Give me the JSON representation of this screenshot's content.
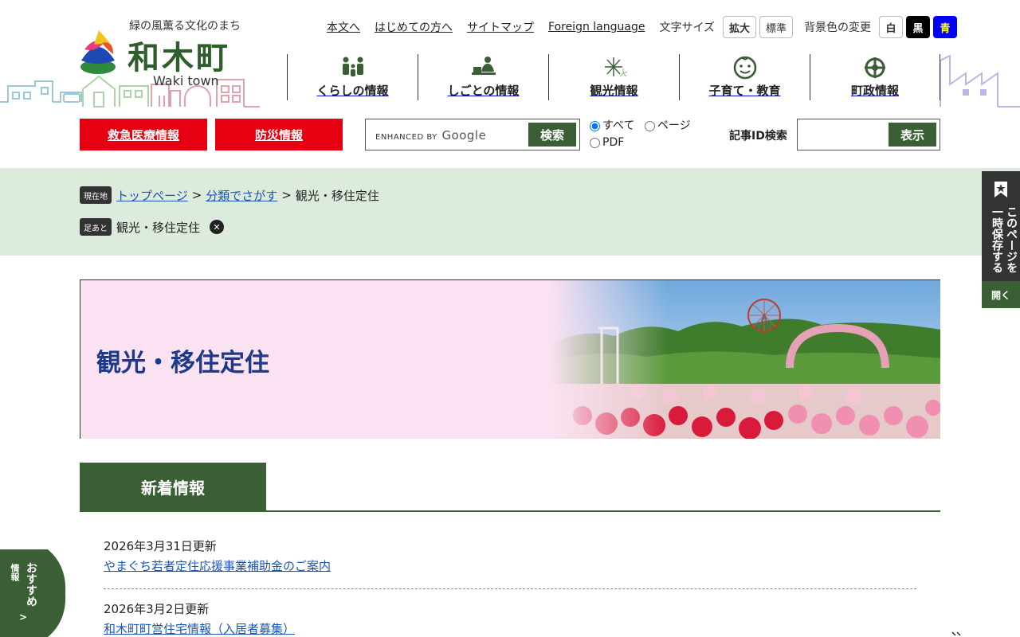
{
  "header": {
    "tagline": "緑の風薫る文化のまち",
    "town_name": "和木町",
    "town_name_en": "Waki town"
  },
  "utility": {
    "links": [
      "本文へ",
      "はじめての方へ",
      "サイトマップ",
      "Foreign language"
    ],
    "font_size_label": "文字サイズ",
    "font_size_buttons": [
      "拡大",
      "標準"
    ],
    "bg_color_label": "背景色の変更",
    "bg_color_buttons": [
      "白",
      "黒",
      "青"
    ]
  },
  "global_nav": [
    {
      "label": "くらしの情報",
      "icon": "family-icon"
    },
    {
      "label": "しごとの情報",
      "icon": "worker-desk-icon"
    },
    {
      "label": "観光情報",
      "icon": "fireworks-icon"
    },
    {
      "label": "子育て・教育",
      "icon": "child-face-icon"
    },
    {
      "label": "町政情報",
      "icon": "town-emblem-icon"
    }
  ],
  "emergency": {
    "medical": "救急医療情報",
    "disaster": "防災情報"
  },
  "search": {
    "enhanced_by": "ENHANCED BY",
    "google": "Google",
    "button": "検索",
    "scope_options": [
      "すべて",
      "ページ",
      "PDF"
    ],
    "scope_selected": "すべて"
  },
  "article_id_search": {
    "label": "記事ID検索",
    "value": "",
    "button": "表示"
  },
  "breadcrumb": {
    "current_tag": "現在地",
    "items": [
      "トップページ",
      "分類でさがす"
    ],
    "separator": ">",
    "current": "観光・移住定住"
  },
  "footprint": {
    "tag": "足あと",
    "items": [
      "観光・移住定住"
    ]
  },
  "hero": {
    "title": "観光・移住定住"
  },
  "news": {
    "tab_label": "新着情報",
    "items": [
      {
        "date": "2026年3月31日更新",
        "title": "やまぐち若者定住応援事業補助金のご案内"
      },
      {
        "date": "2026年3月2日更新",
        "title": "和木町町営住宅情報（入居者募集）"
      }
    ]
  },
  "side_tab": {
    "label": "このページを一時保存する",
    "open": "開く"
  },
  "recommend": {
    "label": "おすすめ",
    "sub": "情報",
    "arrow": ">"
  },
  "colors": {
    "brand_green": "#3a5f35",
    "emergency_red": "#e60012",
    "breadcrumb_band": "#dcebdc",
    "hero_pink": "#fae2f2",
    "link_blue": "#1a55b3",
    "hero_title_blue": "#1d3a8a"
  }
}
